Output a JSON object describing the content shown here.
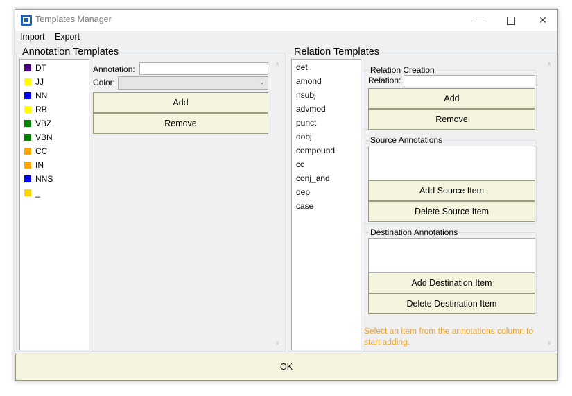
{
  "window": {
    "title": "Templates Manager"
  },
  "menu": {
    "import": "Import",
    "export": "Export"
  },
  "annotation_templates": {
    "title": "Annotation Templates",
    "items": [
      {
        "label": "DT",
        "color": "#4b0082"
      },
      {
        "label": "JJ",
        "color": "#ffff00"
      },
      {
        "label": "NN",
        "color": "#0000ff"
      },
      {
        "label": "RB",
        "color": "#ffff00"
      },
      {
        "label": "VBZ",
        "color": "#008000"
      },
      {
        "label": "VBN",
        "color": "#008000"
      },
      {
        "label": "CC",
        "color": "#ffa500"
      },
      {
        "label": "IN",
        "color": "#ffa500"
      },
      {
        "label": "NNS",
        "color": "#0000ff"
      },
      {
        "label": "_",
        "color": "#ffd700"
      }
    ],
    "annotation_label": "Annotation:",
    "annotation_value": "",
    "color_label": "Color:",
    "color_value": "",
    "add_label": "Add",
    "remove_label": "Remove"
  },
  "relation_templates": {
    "title": "Relation Templates",
    "items": [
      "det",
      "amond",
      "nsubj",
      "advmod",
      "punct",
      "dobj",
      "compound",
      "cc",
      "conj_and",
      "dep",
      "case"
    ],
    "relation_creation": {
      "title": "Relation Creation",
      "relation_label": "Relation:",
      "relation_value": "",
      "add_label": "Add",
      "remove_label": "Remove"
    },
    "source_annotations": {
      "title": "Source Annotations",
      "add_label": "Add Source Item",
      "delete_label": "Delete Source Item"
    },
    "destination_annotations": {
      "title": "Destination Annotations",
      "add_label": "Add Destination Item",
      "delete_label": "Delete Destination Item"
    },
    "hint": "Select an item from the annotations column to start adding."
  },
  "ok_label": "OK",
  "colors": {
    "button_bg": "#f4f4df",
    "hint": "#f0a020",
    "group_border": "#d5dfe5"
  }
}
